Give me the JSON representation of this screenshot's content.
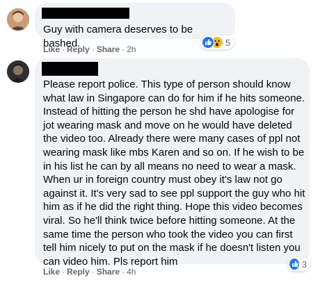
{
  "comments": [
    {
      "author_redacted": true,
      "text": "Guy with camera deserves to be bashed.",
      "actions": {
        "like": "Like",
        "reply": "Reply",
        "share": "Share",
        "time": "2h"
      },
      "reactions": {
        "icons": [
          "like-icon",
          "wow-icon"
        ],
        "count": "5"
      }
    },
    {
      "author_redacted": true,
      "text": "Please report police. This type of person should know what law in Singapore can do for him if he hits someone. Instead of hitting the person he shd have apologise for jot wearing mask and move on he would have deleted the video too. Already there were many cases of ppl not wearing mask like mbs Karen and so on. If he wish to be in his list he can by all means no need to wear a mask. When ur in foreign country must obey it's law not go against it. It's very sad to see ppl support the guy who hit him as if he did the right thing. Hope this video becomes viral. So he'll think twice before hitting someone. At the same time the person who took the video you can first tell him nicely to put on the mask if he doesn't listen you can video him. Pls report him",
      "actions": {
        "like": "Like",
        "reply": "Reply",
        "share": "Share",
        "time": "4h"
      },
      "reactions": {
        "icons": [
          "like-icon"
        ],
        "count": "3"
      }
    }
  ],
  "colors": {
    "bubble": "#f0f2f5",
    "action_text": "#65676b",
    "like_blue": "#1877f2",
    "wow_yellow": "#f7b928"
  }
}
